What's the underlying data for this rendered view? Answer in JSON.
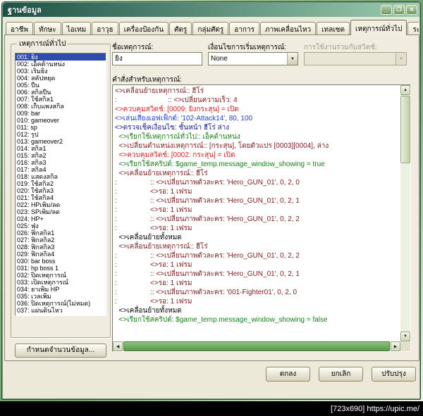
{
  "window": {
    "title": "ฐานข้อมูล",
    "controls": {
      "minimize": "_",
      "maximize": "❐",
      "close": "✕"
    }
  },
  "icons": {
    "dropdown": "▼",
    "scroll_up": "▲",
    "scroll_down": "▼",
    "scroll_left": "◀",
    "scroll_right": "▶"
  },
  "tabs": {
    "items": [
      "อาชีพ",
      "ทักษะ",
      "ไอเทม",
      "อาวุธ",
      "เครื่องป้องกัน",
      "ศัตรู",
      "กลุ่มศัตรู",
      "อาการ",
      "ภาพเคลื่อนไหว",
      "เทลเซต",
      "เหตุการณ์ทั่วไป",
      "ระบบ"
    ],
    "active_index": 10
  },
  "left_panel": {
    "group_title": "เหตุการณ์ทั่วไป",
    "selected_index": 0,
    "items": [
      "001: ยิง",
      "002: เอ็คต้านหน่ง",
      "003: เริ่มยิง",
      "004: สคัปหยุด",
      "005: ปืน",
      "006: สกิลปืน",
      "007: ใช้สกิล1",
      "008: เก็บแพงสกิล",
      "009: bar",
      "010: gameover",
      "011: sp",
      "012: รูป",
      "013: gameover2",
      "014: สกิล1",
      "015: สกิล2",
      "016: สกิล3",
      "017: สกิล4",
      "018: แสดงสกิล",
      "019: ใช้สกิล2",
      "020: ใช้สกิล3",
      "021: ใช้สกิล4",
      "022: HPเพิ่ม/ลด",
      "023: SPเพิ่ม/ลด",
      "024: HP+",
      "025: ฟุ่ง",
      "026: ฟิกสกิล1",
      "027: ฟิกสกิล2",
      "028: ฟิกสกิล3",
      "029: ฟิกสกิล4",
      "030: bar boss",
      "031: hp boss 1",
      "032: ปิดเหตุการณ์",
      "033: เปิดเหตุการณ์",
      "034: ยาเพิ่ม HP",
      "035: เวลเพิ่ม",
      "036: ปิดเหตุการณ์(ไม่หมด)",
      "037: แผ่นดินไหว"
    ],
    "max_button": "กำหนดจำนวนข้อมูล..."
  },
  "editor": {
    "name": {
      "label": "ชื่อเหตุการณ์:",
      "value": "ยิง"
    },
    "trigger": {
      "label": "เงื่อนไขการเริ่มเหตุการณ์:",
      "value": "None"
    },
    "condition_switch": {
      "label": "การใช้งานร่วมกับสวิตช์:",
      "value": "",
      "enabled": false
    },
    "commands_label": "คำสั่งสำหรับเหตุการณ์:",
    "commands": [
      {
        "text": "<>เคลื่อนย้ายเหตุการณ์:: ฮีโร่",
        "color": "move"
      },
      {
        "text": ":                          :: <>เปลี่ยนความเร็ว: 4",
        "color": "move"
      },
      {
        "text": "<>ควบคุมสวิตช์: [0009: ยิงกระสุน] = เปิด",
        "color": "switch"
      },
      {
        "text": "<>เล่นเสียงเอฟเฟ็กต์: '102-Attack14', 80, 100",
        "color": "sound"
      },
      {
        "text": "<>ตรวจเช็คเงื่อนไข: ชั้นหน้า ฮีโร่ ล่าง",
        "color": "condition"
      },
      {
        "text": "  <>เรียกใช้เหตุการณ์ทั่วไป:: เอ็คต้านหน่ง",
        "color": "script"
      },
      {
        "text": "  <>เปลี่ยนตำแหน่งเหตุการณ์:: [กระสุน], โดยตัวแปร [0003][0004], ล่าง",
        "color": "move"
      },
      {
        "text": "  <>ควบคุมสวิตช์: [0002: กระสุน] = เปิด",
        "color": "switch"
      },
      {
        "text": "  <>เรียกใช้สคริปต์: $game_temp.message_window_showing = true",
        "color": "script"
      },
      {
        "text": "  <>เคลื่อนย้ายเหตุการณ์:: ฮีโร่",
        "color": "move"
      },
      {
        "text": ":                 :: <>เปลี่ยนภาพตัวละคร: 'Hero_GUN_01', 0, 2, 0",
        "color": "move"
      },
      {
        "text": ":                 <>รอ: 1 เฟรม",
        "color": "move"
      },
      {
        "text": ":                 :: <>เปลี่ยนภาพตัวละคร: 'Hero_GUN_01', 0, 2, 1",
        "color": "move"
      },
      {
        "text": ":                 <>รอ: 1 เฟรม",
        "color": "move"
      },
      {
        "text": ":                 :: <>เปลี่ยนภาพตัวละคร: 'Hero_GUN_01', 0, 2, 2",
        "color": "move"
      },
      {
        "text": ":                 <>รอ: 1 เฟรม",
        "color": "move"
      },
      {
        "text": "  <>เคลื่อนย้ายทั้งหมด",
        "color": "plain"
      },
      {
        "text": "  <>เคลื่อนย้ายเหตุการณ์:: ฮีโร่",
        "color": "move"
      },
      {
        "text": ":                 :: <>เปลี่ยนภาพตัวละคร: 'Hero_GUN_01', 0, 2, 2",
        "color": "move"
      },
      {
        "text": ":                 <>รอ: 1 เฟรม",
        "color": "move"
      },
      {
        "text": ":                 :: <>เปลี่ยนภาพตัวละคร: 'Hero_GUN_01', 0, 2, 1",
        "color": "move"
      },
      {
        "text": ":                 <>รอ: 1 เฟรม",
        "color": "move"
      },
      {
        "text": ":                 :: <>เปลี่ยนภาพตัวละคร: '001-Fighter01', 0, 2, 0",
        "color": "move"
      },
      {
        "text": ":                 <>รอ: 1 เฟรม",
        "color": "move"
      },
      {
        "text": "  <>เคลื่อนย้ายทั้งหมด",
        "color": "plain"
      },
      {
        "text": "  <>เรียกใช้สคริปต์: $game_temp.message_window_showing = false",
        "color": "script"
      }
    ]
  },
  "footer": {
    "ok": "ตกลง",
    "cancel": "ยกเลิก",
    "apply": "ปรับปรุง"
  },
  "watermark": "[723x690] https://upic.me/",
  "colors": {
    "move": "#7d1d1d",
    "switch": "#d42222",
    "sound": "#2240c8",
    "condition": "#16168c",
    "script": "#168016",
    "plain": "#000000",
    "selection": "#2f4bad",
    "titlebar_left": "#1d5245",
    "titlebar_right": "#9ccbb0"
  }
}
